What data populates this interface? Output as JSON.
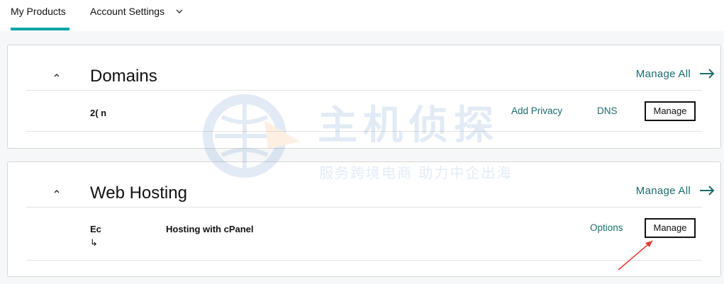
{
  "tabs": [
    {
      "label": "My Products",
      "active": true
    },
    {
      "label": "Account Settings",
      "active": false
    }
  ],
  "domains": {
    "title": "Domains",
    "manage_all": "Manage All",
    "row": {
      "name": "2(                      n",
      "add_privacy": "Add Privacy",
      "dns": "DNS",
      "manage": "Manage"
    }
  },
  "hosting": {
    "title": "Web Hosting",
    "manage_all": "Manage All",
    "row": {
      "name_prefix": "Ec",
      "name_suffix": "Hosting with cPanel",
      "sub_icon": "↳",
      "options": "Options",
      "manage": "Manage"
    }
  },
  "watermark": {
    "text": "主机侦探",
    "subtitle": "服务跨境电商 助力中企出海"
  },
  "colors": {
    "accent": "#00a4a6",
    "link": "#1b6b6e",
    "annotation": "#e53935"
  },
  "icons": [
    "chevron-down-icon",
    "chevron-up-icon",
    "arrow-right-icon",
    "return-arrow-icon"
  ]
}
